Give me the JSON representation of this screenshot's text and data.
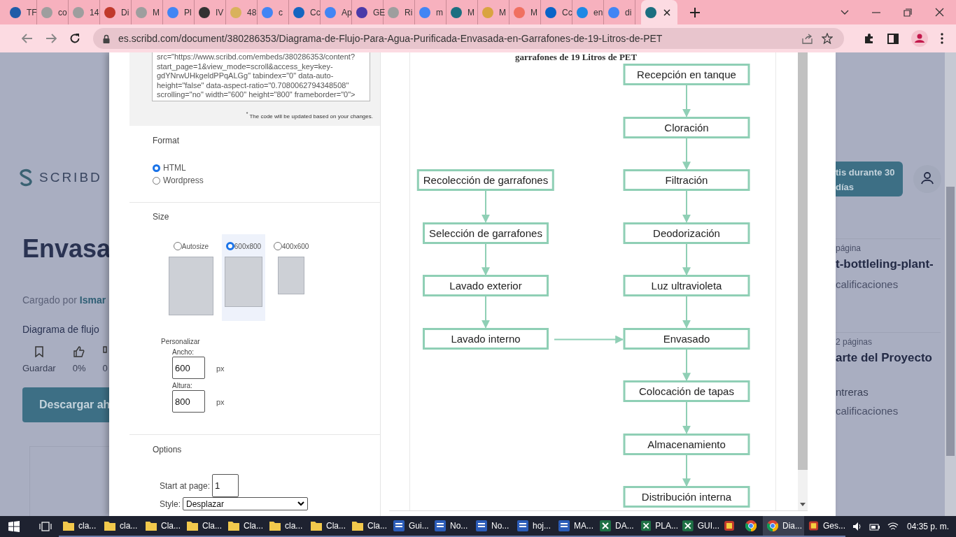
{
  "browser": {
    "tabs": [
      {
        "label": "TF",
        "color": "#1f5ca8",
        "selected": false
      },
      {
        "label": "co",
        "color": "#9e9e9e",
        "selected": false
      },
      {
        "label": "14",
        "color": "#9e9e9e",
        "selected": false
      },
      {
        "label": "Di",
        "color": "#c0392b",
        "selected": false
      },
      {
        "label": "M",
        "color": "#9e9e9e",
        "selected": false
      },
      {
        "label": "Pl",
        "color": "#4285f4",
        "selected": false
      },
      {
        "label": "IV",
        "color": "#333333",
        "selected": false
      },
      {
        "label": "48",
        "color": "#d9b25c",
        "selected": false
      },
      {
        "label": "c",
        "color": "#4285f4",
        "selected": false
      },
      {
        "label": "Cc",
        "color": "#1565c0",
        "selected": false
      },
      {
        "label": "Ap",
        "color": "#4285f4",
        "selected": false
      },
      {
        "label": "GE",
        "color": "#4a3aa8",
        "selected": false
      },
      {
        "label": "Ri",
        "color": "#9e9e9e",
        "selected": false
      },
      {
        "label": "m",
        "color": "#4285f4",
        "selected": false
      },
      {
        "label": "M",
        "color": "#1b6f80",
        "selected": false
      },
      {
        "label": "M",
        "color": "#d9a441",
        "selected": false
      },
      {
        "label": "M",
        "color": "#f07060",
        "selected": false
      },
      {
        "label": "Cc",
        "color": "#0a64c8",
        "selected": false
      },
      {
        "label": "en",
        "color": "#1e88e5",
        "selected": false
      },
      {
        "label": "di",
        "color": "#4285f4",
        "selected": false
      },
      {
        "color": "#1b6f80",
        "selected": true
      }
    ],
    "url": "es.scribd.com/document/380286353/Diagrama-de-Flujo-Para-Agua-Purificada-Envasada-en-Garrafones-de-19-Litros-de-PET"
  },
  "page": {
    "logo": "SCRIBD",
    "title": "Envasa",
    "uploaded_by_label": "Cargado por",
    "uploader": "Ismar",
    "description": "Diagrama de flujo",
    "actions": [
      "Guardar",
      "0%",
      "0"
    ],
    "download_button": "Descargar ah",
    "trial_button": "tis durante 30 días",
    "related": [
      {
        "pages": "página",
        "title": "t-bottleling-plant-",
        "rating": "calificaciones"
      },
      {
        "pages": "2 páginas",
        "title": "arte del Proyecto",
        "author": "ntreras",
        "rating": "calificaciones"
      }
    ]
  },
  "embed": {
    "code": "src=\"https://www.scribd.com/embeds/380286353/content?start_page=1&view_mode=scroll&access_key=key-gdYNrwUHkgeldPPqALGg\" tabindex=\"0\" data-auto-height=\"false\" data-aspect-ratio=\"0.7080062794348508\" scrolling=\"no\" width=\"600\" height=\"800\" frameborder=\"0\">",
    "code_note": "$^{*}$ The code will be updated based on your changes.",
    "format": {
      "label": "Format",
      "options": [
        {
          "label": "HTML",
          "selected": true
        },
        {
          "label": "Wordpress",
          "selected": false
        }
      ]
    },
    "size": {
      "label": "Size",
      "options": [
        {
          "label": "Autosize",
          "selected": false
        },
        {
          "label": "600x800",
          "selected": true
        },
        {
          "label": "400x600",
          "selected": false
        }
      ],
      "custom_label": "Personalizar",
      "width_label": "Ancho:",
      "width_value": "600",
      "width_unit": "px",
      "height_label": "Altura:",
      "height_value": "800",
      "height_unit": "px"
    },
    "options": {
      "label": "Options",
      "start_page_label": "Start at page:",
      "start_page": "1",
      "style_label": "Style:",
      "style_value": "Desplazar"
    }
  },
  "preview": {
    "title": "garrafones de 19 Litros de PET",
    "main_steps": [
      "Recepción en tanque",
      "Cloración",
      "Filtración",
      "Deodorización",
      "Luz ultravioleta",
      "Envasado",
      "Colocación de tapas",
      "Almacenamiento",
      "Distribución interna"
    ],
    "side_steps": [
      "Recolección de garrafones",
      "Selección de garrafones",
      "Lavado exterior",
      "Lavado interno"
    ]
  },
  "taskbar": {
    "items": [
      {
        "kind": "folder",
        "label": "cla...",
        "selected": false
      },
      {
        "kind": "folder",
        "label": "cla...",
        "selected": false
      },
      {
        "kind": "folder",
        "label": "Cla...",
        "selected": false
      },
      {
        "kind": "folder",
        "label": "Cla...",
        "selected": false
      },
      {
        "kind": "folder",
        "label": "Cla...",
        "selected": false
      },
      {
        "kind": "folder",
        "label": "cla...",
        "selected": false
      },
      {
        "kind": "folder",
        "label": "Cla...",
        "selected": false
      },
      {
        "kind": "folder",
        "label": "Cla...",
        "selected": false
      },
      {
        "kind": "word",
        "label": "Gui...",
        "selected": false
      },
      {
        "kind": "word",
        "label": "No...",
        "selected": false
      },
      {
        "kind": "word",
        "label": "No...",
        "selected": false
      },
      {
        "kind": "word",
        "label": "hoj...",
        "selected": false
      },
      {
        "kind": "word",
        "label": "MA...",
        "selected": false
      },
      {
        "kind": "excel",
        "label": "DA...",
        "selected": false
      },
      {
        "kind": "excel",
        "label": "PLA...",
        "selected": false
      },
      {
        "kind": "excel",
        "label": "GUI...",
        "selected": false
      },
      {
        "kind": "app",
        "selected": false
      },
      {
        "kind": "chrome",
        "selected": false
      },
      {
        "kind": "chrome",
        "label": "Dia...",
        "selected": true
      },
      {
        "kind": "app",
        "label": "Ges...",
        "selected": false
      }
    ],
    "clock": "04:35 p. m."
  }
}
